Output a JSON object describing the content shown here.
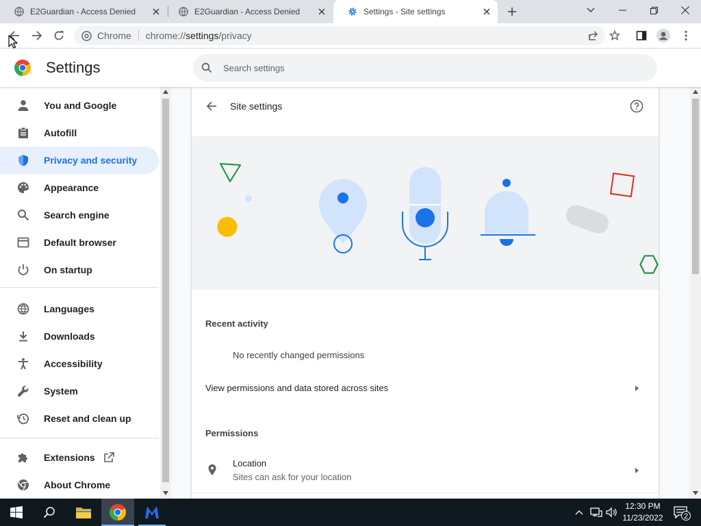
{
  "browser": {
    "tabs": [
      {
        "title": "E2Guardian - Access Denied",
        "active": false
      },
      {
        "title": "E2Guardian - Access Denied",
        "active": false
      },
      {
        "title": "Settings - Site settings",
        "active": true
      }
    ],
    "omnibox": {
      "site_label": "Chrome",
      "url_scheme": "chrome://",
      "url_host": "settings",
      "url_path": "/privacy"
    }
  },
  "settings": {
    "title": "Settings",
    "search_placeholder": "Search settings",
    "sidebar": {
      "items": [
        {
          "label": "You and Google",
          "icon": "person-icon"
        },
        {
          "label": "Autofill",
          "icon": "clipboard-icon"
        },
        {
          "label": "Privacy and security",
          "icon": "shield-icon",
          "selected": true
        },
        {
          "label": "Appearance",
          "icon": "palette-icon"
        },
        {
          "label": "Search engine",
          "icon": "search-icon"
        },
        {
          "label": "Default browser",
          "icon": "browser-icon"
        },
        {
          "label": "On startup",
          "icon": "power-icon"
        },
        {
          "label": "Languages",
          "icon": "globe-icon"
        },
        {
          "label": "Downloads",
          "icon": "download-icon"
        },
        {
          "label": "Accessibility",
          "icon": "accessibility-icon"
        },
        {
          "label": "System",
          "icon": "wrench-icon"
        },
        {
          "label": "Reset and clean up",
          "icon": "history-icon"
        },
        {
          "label": "Extensions",
          "icon": "puzzle-icon"
        },
        {
          "label": "About Chrome",
          "icon": "chrome-icon"
        }
      ]
    },
    "page": {
      "title": "Site settings",
      "recent_activity": {
        "heading": "Recent activity",
        "empty_text": "No recently changed permissions"
      },
      "view_permissions_label": "View permissions and data stored across sites",
      "permissions": {
        "heading": "Permissions",
        "items": [
          {
            "label": "Location",
            "sublabel": "Sites can ask for your location",
            "icon": "location-pin-icon"
          }
        ]
      }
    }
  },
  "taskbar": {
    "time": "12:30 PM",
    "date": "11/23/2022",
    "notification_count": "2"
  },
  "colors": {
    "accent": "#1a73e8",
    "selected_bg": "#e8f0fe",
    "taskbar": "#101820"
  }
}
